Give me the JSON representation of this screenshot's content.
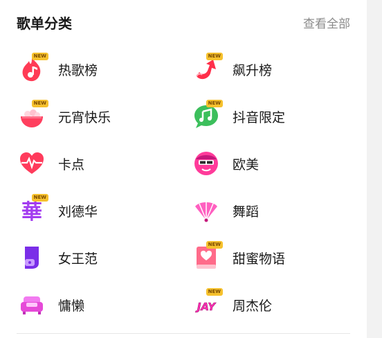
{
  "header": {
    "title": "歌单分类",
    "view_all": "查看全部"
  },
  "badge_text": "NEW",
  "categories": [
    {
      "label": "热歌榜",
      "icon": "flame-music-note-icon",
      "new": true
    },
    {
      "label": "飙升榜",
      "icon": "rising-arrow-icon",
      "new": true
    },
    {
      "label": "元宵快乐",
      "icon": "rice-dumpling-bowl-icon",
      "new": true
    },
    {
      "label": "抖音限定",
      "icon": "music-chat-bubble-icon",
      "new": true
    },
    {
      "label": "卡点",
      "icon": "heartbeat-heart-icon",
      "new": false
    },
    {
      "label": "欧美",
      "icon": "sunglasses-face-icon",
      "new": false
    },
    {
      "label": "刘德华",
      "icon": "hua-character-icon",
      "new": true
    },
    {
      "label": "舞蹈",
      "icon": "hand-fan-icon",
      "new": false
    },
    {
      "label": "女王范",
      "icon": "queen-boot-icon",
      "new": false
    },
    {
      "label": "甜蜜物语",
      "icon": "heart-book-icon",
      "new": true
    },
    {
      "label": "慵懒",
      "icon": "sofa-icon",
      "new": false
    },
    {
      "label": "周杰伦",
      "icon": "jay-logo-icon",
      "new": true
    }
  ],
  "colors": {
    "pink": "#ff3b7a",
    "magenta": "#e64ad8",
    "purple": "#8e3bf0",
    "green": "#3cbf5c",
    "badge": "#f6c12d"
  }
}
